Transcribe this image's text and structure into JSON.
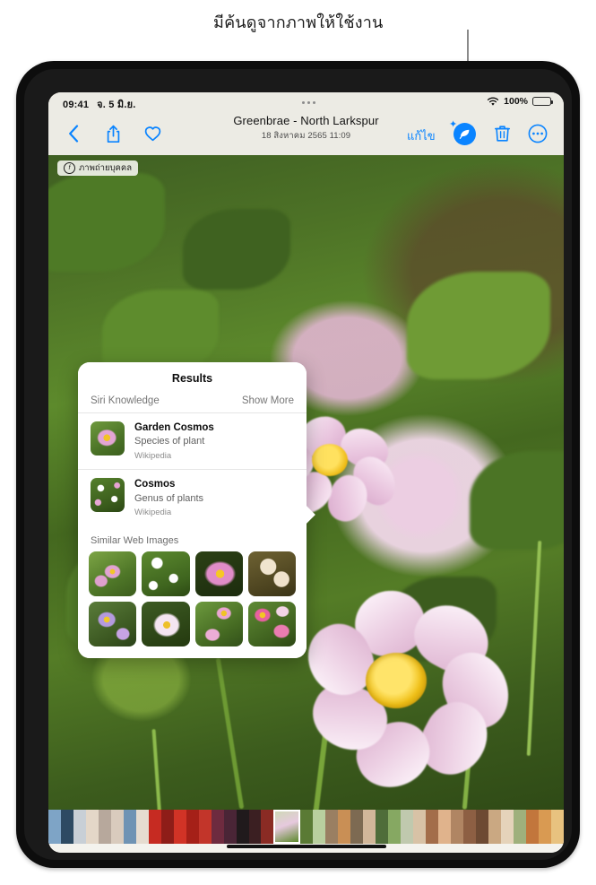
{
  "callout": {
    "text": "มีค้นดูจากภาพให้ใช้งาน"
  },
  "status_bar": {
    "time": "09:41",
    "date": "จ. 5 มิ.ย.",
    "wifi_icon": "wifi-icon",
    "battery_percent": "100%",
    "battery_icon": "battery-icon",
    "dots_icon": "multitasking-dots-icon"
  },
  "toolbar": {
    "back_icon": "chevron-left-icon",
    "share_icon": "share-icon",
    "favorite_icon": "heart-icon",
    "edit_label": "แก้ไข",
    "visual_lookup_icon": "visual-look-up-icon",
    "trash_icon": "trash-icon",
    "more_icon": "more-ellipsis-icon"
  },
  "title": {
    "main": "Greenbrae - North Larkspur",
    "sub": "18 สิงหาคม 2565   11:09"
  },
  "photo": {
    "badge_label": "ภาพถ่ายบุคคล",
    "badge_icon": "aperture-f-icon"
  },
  "results_popover": {
    "title": "Results",
    "section_label": "Siri Knowledge",
    "show_more_label": "Show More",
    "knowledge_items": [
      {
        "name": "Garden Cosmos",
        "description": "Species of plant",
        "source": "Wikipedia",
        "thumb": "garden-cosmos-thumb"
      },
      {
        "name": "Cosmos",
        "description": "Genus of plants",
        "source": "Wikipedia",
        "thumb": "cosmos-genus-thumb"
      }
    ],
    "similar_label": "Similar Web Images",
    "similar_images": [
      "cosmos-field-pink",
      "cosmos-white-cluster",
      "cosmos-pink-closeup",
      "cosmos-cream-blooms",
      "cosmos-purple-mix",
      "cosmos-white-single",
      "cosmos-pink-garden",
      "cosmos-magenta-cluster"
    ]
  },
  "filmstrip": {
    "selected_index": 18,
    "thumbs": [
      "#7ea4c6",
      "#2d4a63",
      "#c8cfd6",
      "#e4d7c8",
      "#b7a89c",
      "#d9cbbd",
      "#6f93b4",
      "#e6dcd0",
      "#c62b22",
      "#8e1d18",
      "#d13326",
      "#a52018",
      "#c2352a",
      "#6e2b3f",
      "#4a2536",
      "#201a1c",
      "#3b1f22",
      "#8a2b24",
      "#e9dfd2",
      "#5a7a35",
      "#b9cf9f",
      "#9a7f62",
      "#c98f55",
      "#7d6a52",
      "#d2b79a",
      "#4f6d3a",
      "#86a862",
      "#c0c9ae",
      "#d8c2a6",
      "#a36d4a",
      "#e0b38c",
      "#b08563",
      "#8d5f43",
      "#6d4a33",
      "#caa882",
      "#e5d3ba",
      "#9fb07c",
      "#c2763c",
      "#d99a52",
      "#e8c27f"
    ]
  }
}
